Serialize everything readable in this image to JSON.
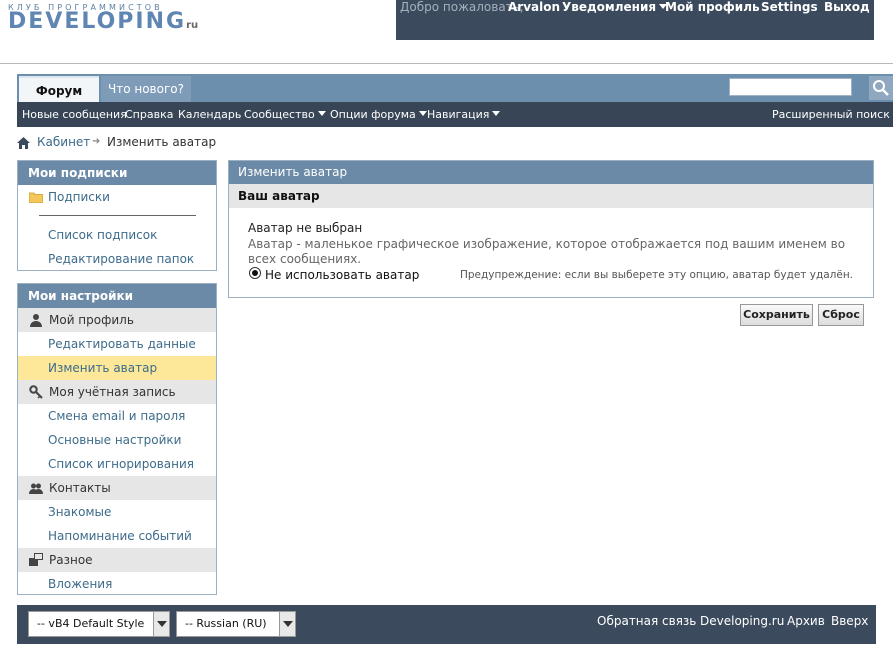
{
  "logo": {
    "tagline": "КЛУБ ПРОГРАММИСТОВ",
    "name": "DEVELOPING",
    "suffix": "ru"
  },
  "toplinks": {
    "welcome": "Добро пожаловать,",
    "username": "Arvalon",
    "notifications": "Уведомления",
    "profile": "Мой профиль",
    "settings": "Settings",
    "logout": "Выход"
  },
  "navtabs": {
    "active": "Форум",
    "other": "Что нового?"
  },
  "search": {
    "placeholder": "",
    "value": ""
  },
  "subnav": {
    "items": [
      "Новые сообщения",
      "Справка",
      "Календарь",
      "Сообщество",
      "Опции форума",
      "Навигация"
    ],
    "advanced_search": "Расширенный поиск"
  },
  "breadcrumb": {
    "root": "Кабинет",
    "current": "Изменить аватар"
  },
  "subscriptions": {
    "title": "Мои подписки",
    "folder": "Подписки",
    "links": [
      "Список подписок",
      "Редактирование папок"
    ]
  },
  "settings_block": {
    "title": "Мои настройки",
    "sections": [
      {
        "label": "Мой профиль",
        "icon": "user-icon",
        "links": [
          "Редактировать данные",
          "Изменить аватар"
        ]
      },
      {
        "label": "Моя учётная запись",
        "icon": "key-icon",
        "links": [
          "Смена email и пароля",
          "Основные настройки",
          "Список игнорирования"
        ]
      },
      {
        "label": "Контакты",
        "icon": "contacts-icon",
        "links": [
          "Знакомые",
          "Напоминание событий"
        ]
      },
      {
        "label": "Разное",
        "icon": "misc-icon",
        "links": [
          "Вложения"
        ]
      }
    ],
    "active_link": "Изменить аватар"
  },
  "panel": {
    "title": "Изменить аватар",
    "subtitle": "Ваш аватар",
    "no_avatar": "Аватар не выбран",
    "description": "Аватар - маленькое графическое изображение, которое отображается под вашим именем во всех сообщениях.",
    "radio_label": "Не использовать аватар",
    "warning": "Предупреждение: если вы выберете эту опцию, аватар будет удалён."
  },
  "buttons": {
    "save": "Сохранить",
    "reset": "Сброс"
  },
  "footer": {
    "style_select": "-- vB4 Default Style",
    "lang_select": "-- Russian (RU)",
    "links": [
      "Обратная связь",
      "Developing.ru",
      "Архив",
      "Вверх"
    ]
  },
  "colors": {
    "header_dark": "#3b4b5d",
    "nav_blue": "#6c8fad",
    "highlight": "#fde89a",
    "link": "#3d6b8a"
  }
}
